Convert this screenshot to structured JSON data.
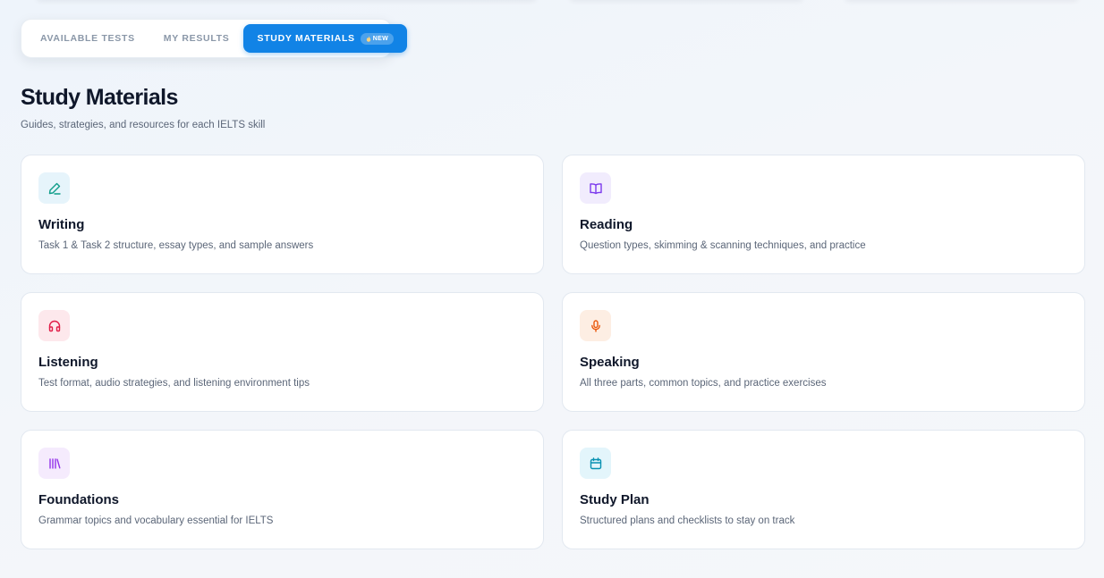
{
  "tabs": [
    {
      "label": "AVAILABLE TESTS",
      "active": false
    },
    {
      "label": "MY RESULTS",
      "active": false
    },
    {
      "label": "STUDY MATERIALS",
      "active": true,
      "badge": "NEW",
      "badge_icon": "flame-icon"
    }
  ],
  "page": {
    "title": "Study Materials",
    "subtitle": "Guides, strategies, and resources for each IELTS skill"
  },
  "cards": [
    {
      "title": "Writing",
      "description": "Task 1 & Task 2 structure, essay types, and sample answers",
      "icon": "pen-icon",
      "icon_color": "#0f9d8a",
      "icon_bg": "#e6f4fb"
    },
    {
      "title": "Reading",
      "description": "Question types, skimming & scanning techniques, and practice",
      "icon": "book-open-icon",
      "icon_color": "#7c3aed",
      "icon_bg": "#f1ecfd"
    },
    {
      "title": "Listening",
      "description": "Test format, audio strategies, and listening environment tips",
      "icon": "headphones-icon",
      "icon_color": "#e11d48",
      "icon_bg": "#fde8ec"
    },
    {
      "title": "Speaking",
      "description": "All three parts, common topics, and practice exercises",
      "icon": "microphone-icon",
      "icon_color": "#ea580c",
      "icon_bg": "#fdeee3"
    },
    {
      "title": "Foundations",
      "description": "Grammar topics and vocabulary essential for IELTS",
      "icon": "library-icon",
      "icon_color": "#9333ea",
      "icon_bg": "#f5ebfd"
    },
    {
      "title": "Study Plan",
      "description": "Structured plans and checklists to stay on track",
      "icon": "calendar-icon",
      "icon_color": "#0891b2",
      "icon_bg": "#e3f5fb"
    }
  ],
  "colors": {
    "accent": "#1183e6",
    "text_primary": "#0f172a",
    "text_muted": "#5b6678"
  }
}
